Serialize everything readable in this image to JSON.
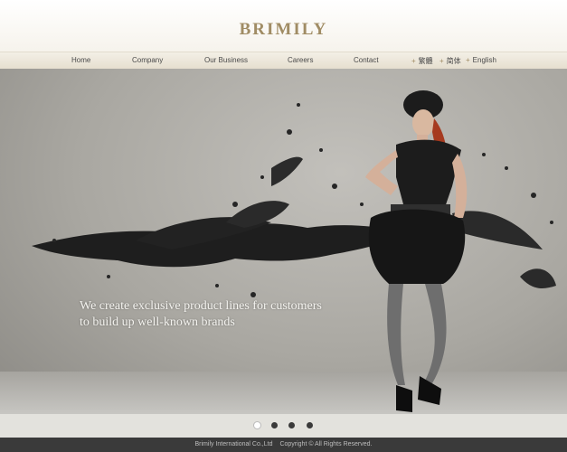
{
  "logo": {
    "text": "BRIMILY"
  },
  "nav": {
    "items": [
      "Home",
      "Company",
      "Our Business",
      "Careers",
      "Contact"
    ],
    "languages": [
      "繁體",
      "简体",
      "English"
    ]
  },
  "hero": {
    "caption_line1": "We create exclusive product lines for customers",
    "caption_line2": "to build up well-known brands"
  },
  "slider": {
    "count": 4,
    "active_index": 0
  },
  "footer": {
    "company": "Brimily International Co.,Ltd",
    "copyright": "Copyright © All Rights Reserved."
  },
  "colors": {
    "accent": "#a08c64",
    "footer_bg": "#3a3a3a"
  },
  "icons": [
    "bullet-icon"
  ]
}
